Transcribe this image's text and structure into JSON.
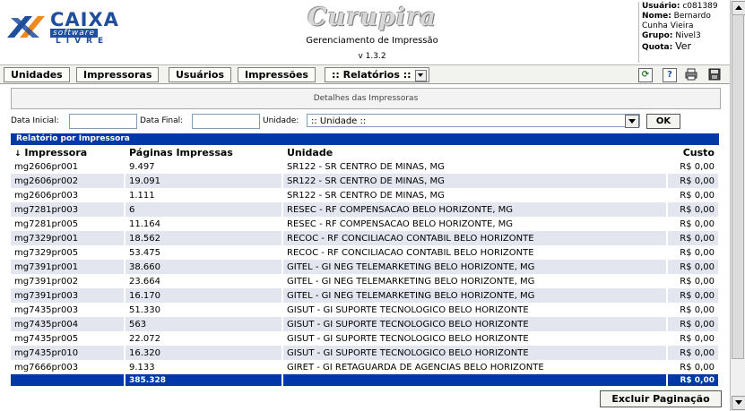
{
  "header": {
    "logo_word": "CAIXA",
    "logo_sub": "software",
    "logo_livre": "LIVRE",
    "app_title": "Curupira",
    "app_subtitle": "Gerenciamento de Impressão",
    "version": "v 1.3.2"
  },
  "user": {
    "usuario_label": "Usuário:",
    "usuario": "c081389",
    "nome_label": "Nome:",
    "nome": "Bernardo Cunha Vieira",
    "grupo_label": "Grupo:",
    "grupo": "Nivel3",
    "quota_label": "Quota:",
    "quota": "Ver"
  },
  "menu": {
    "items": [
      "Unidades",
      "Impressoras",
      "Usuários",
      "Impressões",
      ":: Relatórios ::"
    ],
    "icons": [
      "refresh-icon",
      "help-icon",
      "print-icon",
      "save-icon"
    ]
  },
  "detail_title": "Detalhes das Impressoras",
  "filter": {
    "data_inicial_label": "Data Inicial:",
    "data_inicial_value": "",
    "data_final_label": "Data Final:",
    "data_final_value": "",
    "unidade_label": "Unidade:",
    "unidade_selected": ":: Unidade ::",
    "ok_label": "OK"
  },
  "report": {
    "title": "Relatório por Impressora",
    "sort_indicator": "↓",
    "columns": [
      "Impressora",
      "Páginas Impressas",
      "Unidade",
      "Custo"
    ],
    "rows": [
      {
        "impressora": "mg2606pr001",
        "paginas": "9.497",
        "unidade": "SR122 - SR CENTRO DE MINAS, MG",
        "custo": "R$ 0,00"
      },
      {
        "impressora": "mg2606pr002",
        "paginas": "19.091",
        "unidade": "SR122 - SR CENTRO DE MINAS, MG",
        "custo": "R$ 0,00"
      },
      {
        "impressora": "mg2606pr003",
        "paginas": "1.111",
        "unidade": "SR122 - SR CENTRO DE MINAS, MG",
        "custo": "R$ 0,00"
      },
      {
        "impressora": "mg7281pr003",
        "paginas": "6",
        "unidade": "RESEC - RF COMPENSACAO BELO HORIZONTE, MG",
        "custo": "R$ 0,00"
      },
      {
        "impressora": "mg7281pr005",
        "paginas": "11.164",
        "unidade": "RESEC - RF COMPENSACAO BELO HORIZONTE, MG",
        "custo": "R$ 0,00"
      },
      {
        "impressora": "mg7329pr001",
        "paginas": "18.562",
        "unidade": "RECOC - RF CONCILIACAO CONTABIL BELO HORIZONTE",
        "custo": "R$ 0,00"
      },
      {
        "impressora": "mg7329pr005",
        "paginas": "53.475",
        "unidade": "RECOC - RF CONCILIACAO CONTABIL BELO HORIZONTE",
        "custo": "R$ 0,00"
      },
      {
        "impressora": "mg7391pr001",
        "paginas": "38.660",
        "unidade": "GITEL - GI NEG TELEMARKETING BELO HORIZONTE, MG",
        "custo": "R$ 0,00"
      },
      {
        "impressora": "mg7391pr002",
        "paginas": "23.664",
        "unidade": "GITEL - GI NEG TELEMARKETING BELO HORIZONTE, MG",
        "custo": "R$ 0,00"
      },
      {
        "impressora": "mg7391pr003",
        "paginas": "16.170",
        "unidade": "GITEL - GI NEG TELEMARKETING BELO HORIZONTE, MG",
        "custo": "R$ 0,00"
      },
      {
        "impressora": "mg7435pr003",
        "paginas": "51.330",
        "unidade": "GISUT - GI SUPORTE TECNOLOGICO BELO HORIZONTE",
        "custo": "R$ 0,00"
      },
      {
        "impressora": "mg7435pr004",
        "paginas": "563",
        "unidade": "GISUT - GI SUPORTE TECNOLOGICO BELO HORIZONTE",
        "custo": "R$ 0,00"
      },
      {
        "impressora": "mg7435pr005",
        "paginas": "22.072",
        "unidade": "GISUT - GI SUPORTE TECNOLOGICO BELO HORIZONTE",
        "custo": "R$ 0,00"
      },
      {
        "impressora": "mg7435pr010",
        "paginas": "16.320",
        "unidade": "GISUT - GI SUPORTE TECNOLOGICO BELO HORIZONTE",
        "custo": "R$ 0,00"
      },
      {
        "impressora": "mg7666pr003",
        "paginas": "9.133",
        "unidade": "GIRET - GI RETAGUARDA DE AGENCIAS BELO HORIZONTE",
        "custo": "R$ 0,00"
      }
    ],
    "total_paginas": "385.328",
    "total_custo": "R$ 0,00"
  },
  "excluir_label": "Excluir Paginação",
  "colors": {
    "accent_blue": "#0038a8",
    "row_stripe": "#e3e5ef",
    "logo_blue": "#1f4e9c",
    "logo_orange": "#f08a1e"
  }
}
